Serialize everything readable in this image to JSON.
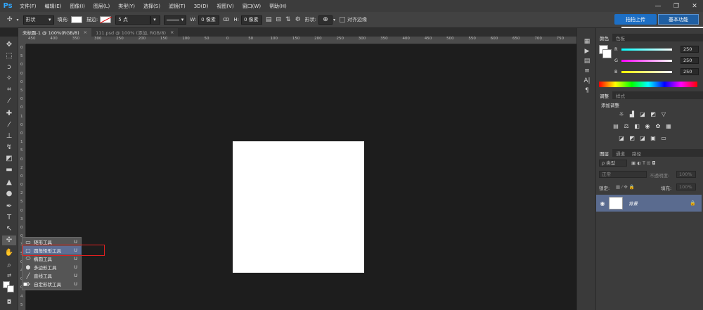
{
  "app": {
    "logo": "Ps"
  },
  "menu": [
    "文件(F)",
    "编辑(E)",
    "图像(I)",
    "图层(L)",
    "类型(Y)",
    "选择(S)",
    "滤镜(T)",
    "3D(D)",
    "视图(V)",
    "窗口(W)",
    "帮助(H)"
  ],
  "window_controls": {
    "minimize": "—",
    "restore": "❐",
    "close": "✕"
  },
  "options": {
    "mode": "形状",
    "fill_label": "填充:",
    "stroke_label": "描边:",
    "stroke_size": "5 点",
    "w_label": "W:",
    "w_value": "0 像素",
    "link_icon": "ꝏ",
    "h_label": "H:",
    "h_value": "0 像素",
    "shape_label": "形状:",
    "align_edges": "对齐边缘",
    "upload": "拍拍上传",
    "workspace": "基本功能"
  },
  "tabs": [
    {
      "label": "未标题-1 @ 100%(RGB/8)",
      "close": "×",
      "active": true
    },
    {
      "label": "111.psd @ 100% (添加, RGB/8)",
      "close": "×",
      "active": false
    }
  ],
  "ruler_h": [
    "450",
    "400",
    "350",
    "300",
    "250",
    "200",
    "150",
    "100",
    "50",
    "0",
    "50",
    "100",
    "150",
    "200",
    "250",
    "300",
    "350",
    "400",
    "450",
    "500",
    "550",
    "600",
    "650",
    "700",
    "750"
  ],
  "ruler_v": [
    "0",
    "5",
    "0",
    "0",
    "0",
    "5",
    "0",
    "0",
    "1",
    "0",
    "0",
    "1",
    "5",
    "0",
    "2",
    "0",
    "0",
    "2",
    "5",
    "0",
    "3",
    "0",
    "0",
    "3",
    "5",
    "0",
    "4",
    "0",
    "0",
    "4",
    "5"
  ],
  "tool_flyout": [
    {
      "label": "矩形工具",
      "key": "U",
      "icon": "▭"
    },
    {
      "label": "圆角矩形工具",
      "key": "U",
      "icon": "▢",
      "highlight": true
    },
    {
      "label": "椭圆工具",
      "key": "U",
      "icon": "⬭"
    },
    {
      "label": "多边形工具",
      "key": "U",
      "icon": "⬢"
    },
    {
      "label": "直线工具",
      "key": "U",
      "icon": "╱"
    },
    {
      "label": "自定形状工具",
      "key": "U",
      "icon": "✣",
      "checked": true
    }
  ],
  "color_panel": {
    "tabs": [
      "颜色",
      "色板"
    ],
    "r": {
      "label": "R",
      "value": "250"
    },
    "g": {
      "label": "G",
      "value": "250"
    },
    "b": {
      "label": "B",
      "value": "250"
    }
  },
  "adjust_panel": {
    "tabs": [
      "调整",
      "样式"
    ],
    "title": "添加调整"
  },
  "layers_panel": {
    "tabs": [
      "图层",
      "通道",
      "路径"
    ],
    "kind": "ρ 类型",
    "blend": "正常",
    "opacity_label": "不透明度:",
    "opacity": "100%",
    "lock_label": "锁定:",
    "fill_label": "填充:",
    "fill": "100%",
    "layer_name": "背景"
  },
  "sogou": {
    "logo": "S",
    "items": [
      "中",
      "☽",
      "°,",
      "⌨",
      "👕",
      "⚒",
      "✿"
    ]
  },
  "colors": {
    "accent": "#1d6fc5",
    "highlight": "#5e6e94",
    "layer_selected": "#5a6b8f",
    "annotation": "#e02020"
  }
}
